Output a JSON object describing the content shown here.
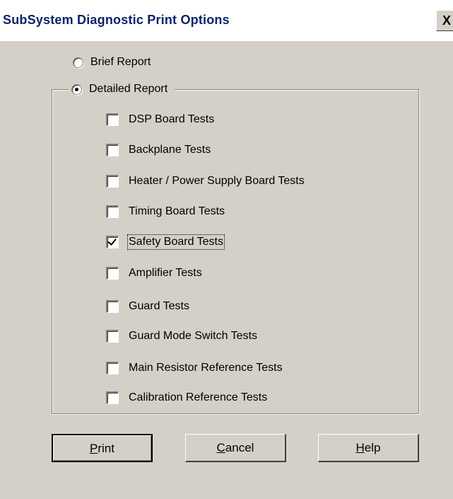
{
  "window": {
    "title": "SubSystem Diagnostic Print Options",
    "close_label": "X"
  },
  "report_type": {
    "brief": {
      "label": "Brief Report",
      "checked": false
    },
    "detailed": {
      "label": "Detailed Report",
      "checked": true
    }
  },
  "tests": [
    {
      "label": "DSP Board Tests",
      "checked": false
    },
    {
      "label": "Backplane Tests",
      "checked": false
    },
    {
      "label": "Heater / Power Supply Board Tests",
      "checked": false
    },
    {
      "label": "Timing Board Tests",
      "checked": false
    },
    {
      "label": "Safety Board Tests",
      "checked": true
    },
    {
      "label": "Amplifier Tests",
      "checked": false
    },
    {
      "label": "Guard Tests",
      "checked": false
    },
    {
      "label": "Guard Mode Switch Tests",
      "checked": false
    },
    {
      "label": "Main Resistor Reference Tests",
      "checked": false
    },
    {
      "label": "Calibration Reference Tests",
      "checked": false
    }
  ],
  "buttons": {
    "print": {
      "label": "Print",
      "accel": "P"
    },
    "cancel": {
      "label": "Cancel",
      "accel": "C"
    },
    "help": {
      "label": "Help",
      "accel": "H"
    }
  }
}
